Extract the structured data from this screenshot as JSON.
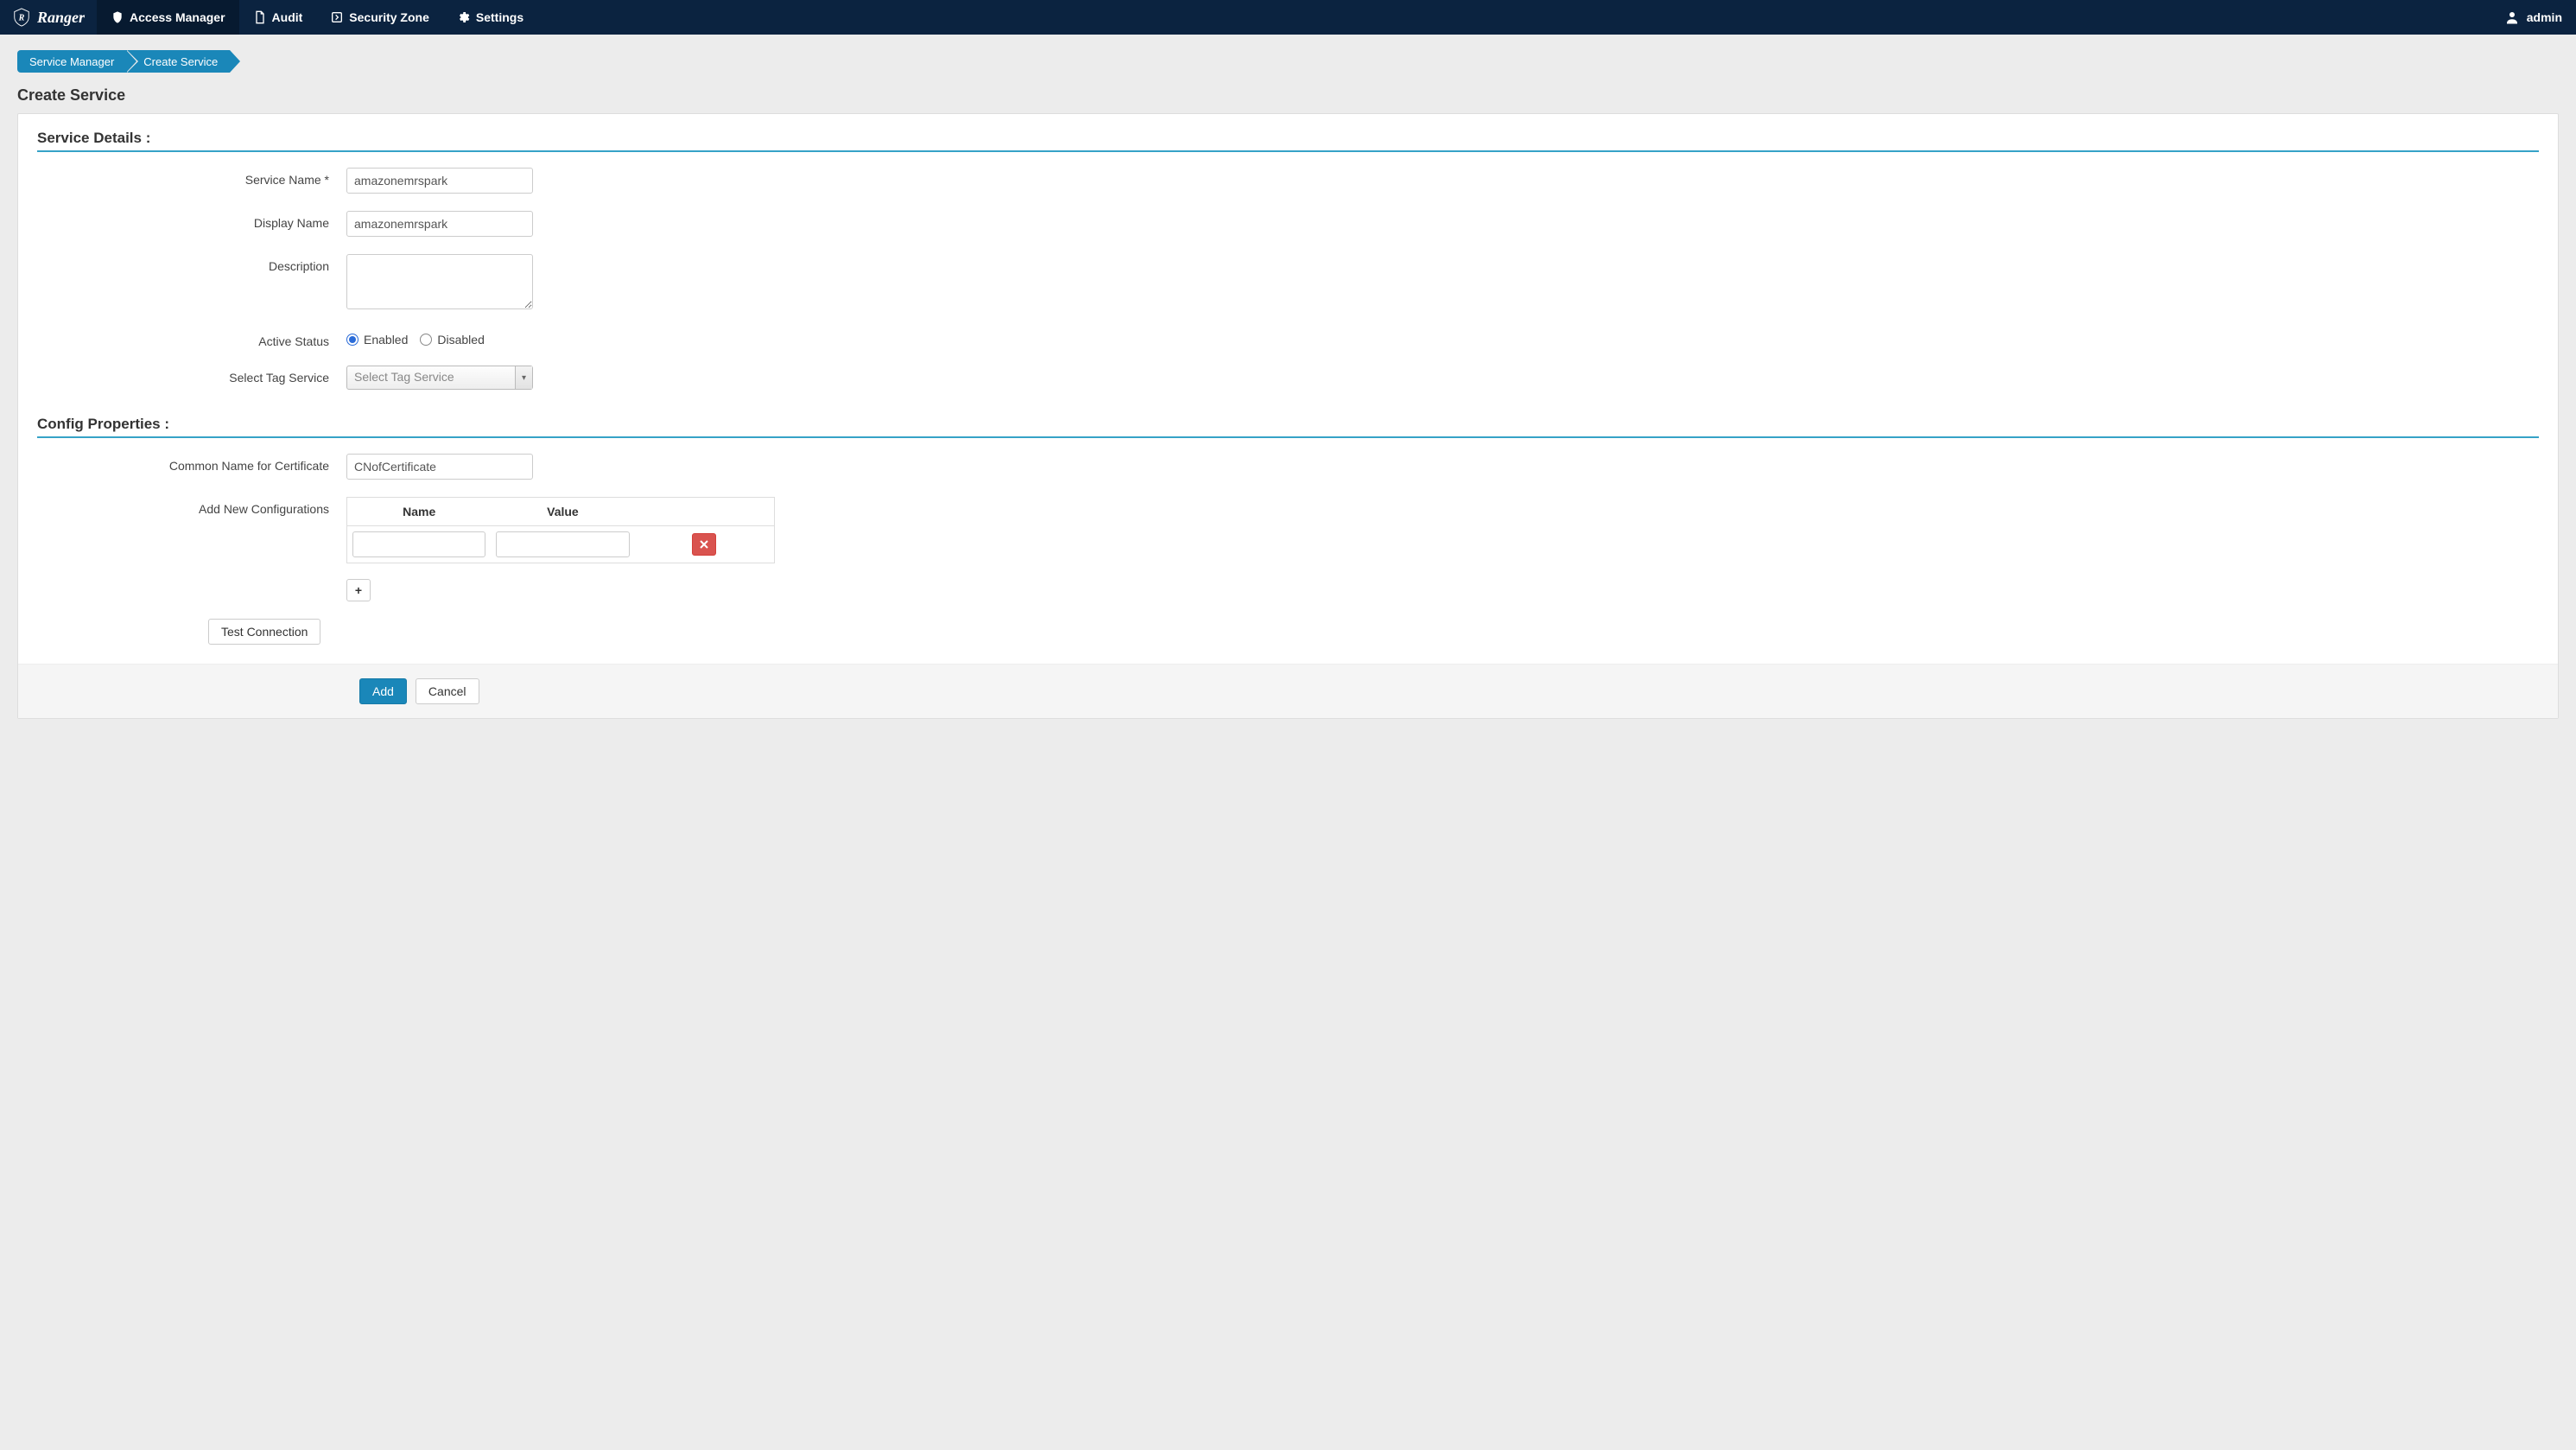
{
  "brand": "Ranger",
  "nav": {
    "access_manager": "Access Manager",
    "audit": "Audit",
    "security_zone": "Security Zone",
    "settings": "Settings"
  },
  "user": {
    "name": "admin"
  },
  "breadcrumb": {
    "items": [
      "Service Manager",
      "Create Service"
    ]
  },
  "page_title": "Create Service",
  "sections": {
    "service_details": "Service Details :",
    "config_properties": "Config Properties :"
  },
  "fields": {
    "service_name": {
      "label": "Service Name *",
      "value": "amazonemrspark"
    },
    "display_name": {
      "label": "Display Name",
      "value": "amazonemrspark"
    },
    "description": {
      "label": "Description",
      "value": ""
    },
    "active_status": {
      "label": "Active Status",
      "options": {
        "enabled": "Enabled",
        "disabled": "Disabled"
      },
      "selected": "enabled"
    },
    "select_tag_service": {
      "label": "Select Tag Service",
      "placeholder": "Select Tag Service"
    },
    "common_name_cert": {
      "label": "Common Name for Certificate",
      "value": "CNofCertificate"
    },
    "add_new_configs": {
      "label": "Add New Configurations",
      "columns": {
        "name": "Name",
        "value": "Value"
      },
      "rows": [
        {
          "name": "",
          "value": ""
        }
      ]
    }
  },
  "buttons": {
    "test_connection": "Test Connection",
    "add": "Add",
    "cancel": "Cancel"
  }
}
